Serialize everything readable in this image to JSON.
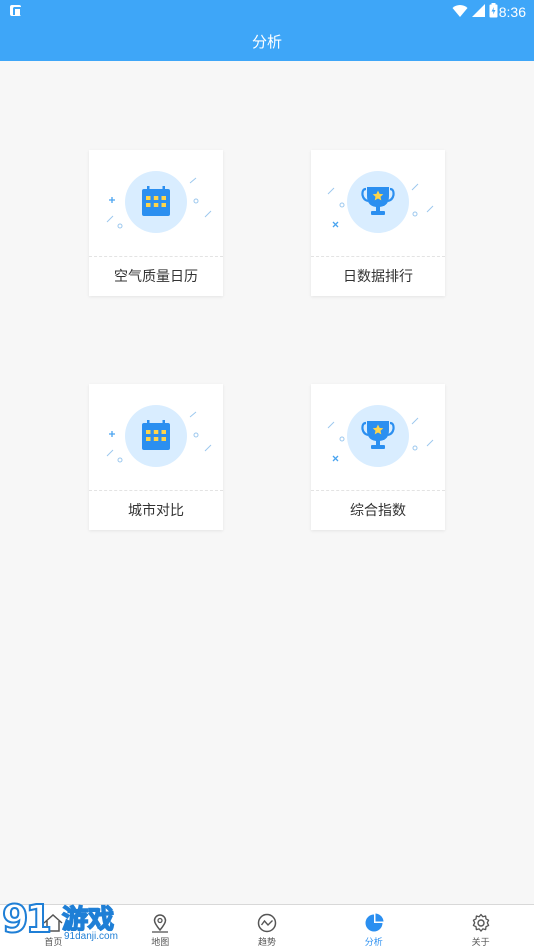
{
  "statusbar": {
    "time": "8:36"
  },
  "header": {
    "title": "分析"
  },
  "cards": [
    {
      "label": "空气质量日历",
      "icon": "calendar-icon"
    },
    {
      "label": "日数据排行",
      "icon": "trophy-icon"
    },
    {
      "label": "城市对比",
      "icon": "calendar-icon"
    },
    {
      "label": "综合指数",
      "icon": "trophy-icon"
    }
  ],
  "tabbar": {
    "active_color": "#2b8ff0",
    "items": [
      {
        "label": "首页",
        "icon": "home-icon"
      },
      {
        "label": "地图",
        "icon": "map-pin-icon"
      },
      {
        "label": "趋势",
        "icon": "trend-icon"
      },
      {
        "label": "分析",
        "icon": "pie-chart-icon"
      },
      {
        "label": "关于",
        "icon": "gear-icon"
      }
    ]
  },
  "watermark": {
    "text": "游戏",
    "url": "91danji.com"
  },
  "colors": {
    "primary": "#3ea6f8",
    "icon_blue": "#2b8ff0",
    "circle_bg": "#d9edff",
    "accent_yellow": "#ffd54a"
  }
}
